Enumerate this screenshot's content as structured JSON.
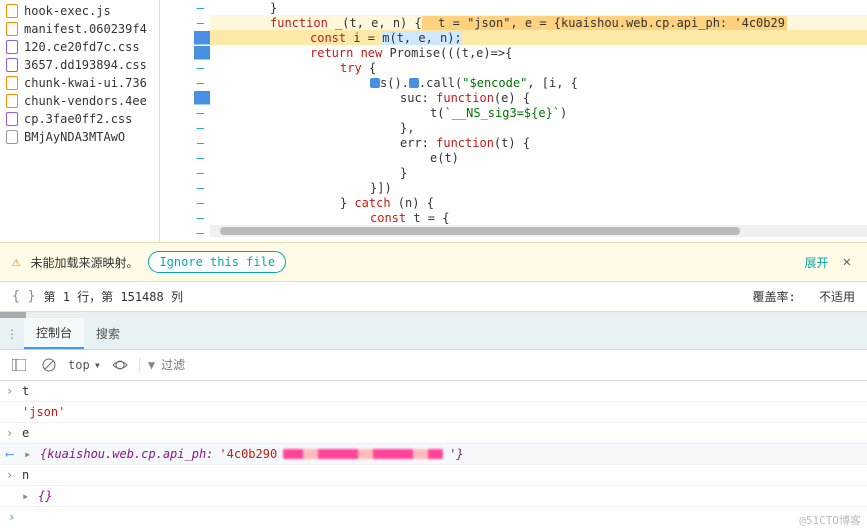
{
  "sidebar": {
    "files": [
      {
        "name": "hook-exec.js",
        "icon": "js"
      },
      {
        "name": "manifest.060239f4",
        "icon": "js"
      },
      {
        "name": "120.ce20fd7c.css",
        "icon": "css"
      },
      {
        "name": "3657.dd193894.css",
        "icon": "css"
      },
      {
        "name": "chunk-kwai-ui.736",
        "icon": "js"
      },
      {
        "name": "chunk-vendors.4ee",
        "icon": "js"
      },
      {
        "name": "cp.3fae0ff2.css",
        "icon": "css"
      },
      {
        "name": "BMjAyNDA3MTAwO",
        "icon": "txt"
      }
    ]
  },
  "gutter_glyph": "–",
  "code": {
    "line1": "}",
    "line2_kw": "function",
    "line2_fn": " _(t, e, n) {",
    "line2_hint": "  t = \"json\", e = {kuaishou.web.cp.api_ph: '4c0b29",
    "line3_kw": "const",
    "line3_rest": " i = ",
    "line3_call": "m(t, e, n);",
    "line4_kw": "return new",
    "line4_rest": " Promise(((t,e)=>{",
    "line5_kw": "try",
    "line5_rest": " {",
    "line6_a": "s().",
    "line6_b": ".call(",
    "line6_str": "\"$encode\"",
    "line6_c": ", [i, {",
    "line7_a": "suc: ",
    "line7_kw": "function",
    "line7_b": "(e) {",
    "line8_a": "t(",
    "line8_str": "`__NS_sig3=${e}`",
    "line8_b": ")",
    "line9": "},",
    "line10_a": "err: ",
    "line10_kw": "function",
    "line10_b": "(t) {",
    "line11": "e(t)",
    "line12": "}",
    "line13": "}])",
    "line14_a": "} ",
    "line14_kw": "catch",
    "line14_b": " (n) {",
    "line15_kw": "const",
    "line15_rest": " t = {"
  },
  "warning": {
    "text": "未能加载来源映射。",
    "button": "Ignore this file",
    "expand": "展开",
    "close": "✕"
  },
  "status": {
    "text": "第 1 行，第 151488 列",
    "coverage_label": "覆盖率:",
    "coverage_value": "不适用"
  },
  "tabs": {
    "console": "控制台",
    "search": "搜索"
  },
  "toolbar": {
    "context": "top",
    "filter_placeholder": "过滤"
  },
  "console_rows": {
    "r1": "t",
    "r2": "'json'",
    "r3": "e",
    "r4_key": "{kuaishou.web.cp.api_ph: ",
    "r4_val": "'4c0b290",
    "r4_end": "'}",
    "r5": "n",
    "r6": "{}"
  },
  "watermark": "@51CTO博客"
}
